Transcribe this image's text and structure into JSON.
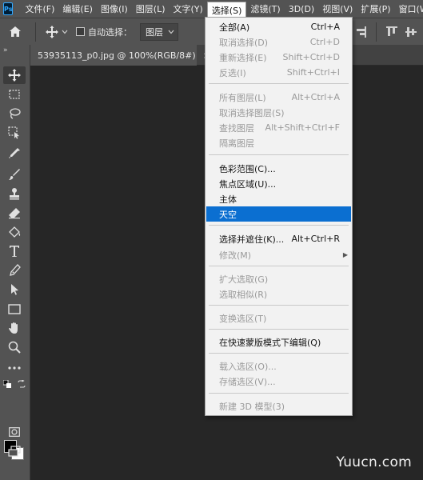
{
  "app": {
    "logo": "Ps"
  },
  "menubar": {
    "items": [
      "文件(F)",
      "编辑(E)",
      "图像(I)",
      "图层(L)",
      "文字(Y)",
      "选择(S)",
      "滤镜(T)",
      "3D(D)",
      "视图(V)",
      "扩展(P)",
      "窗口(W)"
    ],
    "active": "选择(S)"
  },
  "options": {
    "auto_select_label": "自动选择：",
    "layer_select_value": "图层"
  },
  "document_tab": {
    "title": "53935113_p0.jpg @ 100%(RGB/8#)",
    "close": "×"
  },
  "toolbar": {
    "collapse": "»"
  },
  "select_menu": {
    "items": [
      {
        "label": "全部(A)",
        "shortcut": "Ctrl+A",
        "enabled": true
      },
      {
        "label": "取消选择(D)",
        "shortcut": "Ctrl+D",
        "enabled": false
      },
      {
        "label": "重新选择(E)",
        "shortcut": "Shift+Ctrl+D",
        "enabled": false
      },
      {
        "label": "反选(I)",
        "shortcut": "Shift+Ctrl+I",
        "enabled": false
      },
      {
        "label": "所有图层(L)",
        "shortcut": "Alt+Ctrl+A",
        "enabled": false
      },
      {
        "label": "取消选择图层(S)",
        "shortcut": "",
        "enabled": false
      },
      {
        "label": "查找图层",
        "shortcut": "Alt+Shift+Ctrl+F",
        "enabled": false
      },
      {
        "label": "隔离图层",
        "shortcut": "",
        "enabled": false
      },
      {
        "label": "色彩范围(C)...",
        "shortcut": "",
        "enabled": true
      },
      {
        "label": "焦点区域(U)...",
        "shortcut": "",
        "enabled": true
      },
      {
        "label": "主体",
        "shortcut": "",
        "enabled": true
      },
      {
        "label": "天空",
        "shortcut": "",
        "enabled": true,
        "highlighted": true
      },
      {
        "label": "选择并遮住(K)...",
        "shortcut": "Alt+Ctrl+R",
        "enabled": true
      },
      {
        "label": "修改(M)",
        "shortcut": "",
        "enabled": false,
        "submenu": true
      },
      {
        "label": "扩大选取(G)",
        "shortcut": "",
        "enabled": false
      },
      {
        "label": "选取相似(R)",
        "shortcut": "",
        "enabled": false
      },
      {
        "label": "变换选区(T)",
        "shortcut": "",
        "enabled": false
      },
      {
        "label": "在快速蒙版模式下编辑(Q)",
        "shortcut": "",
        "enabled": true
      },
      {
        "label": "载入选区(O)...",
        "shortcut": "",
        "enabled": false
      },
      {
        "label": "存储选区(V)...",
        "shortcut": "",
        "enabled": false
      },
      {
        "label": "新建 3D 模型(3)",
        "shortcut": "",
        "enabled": false
      }
    ]
  },
  "watermark": "Yuucn.com",
  "colors": {
    "highlight": "#0b6fd1",
    "chrome": "#535353",
    "canvas": "#262626"
  }
}
